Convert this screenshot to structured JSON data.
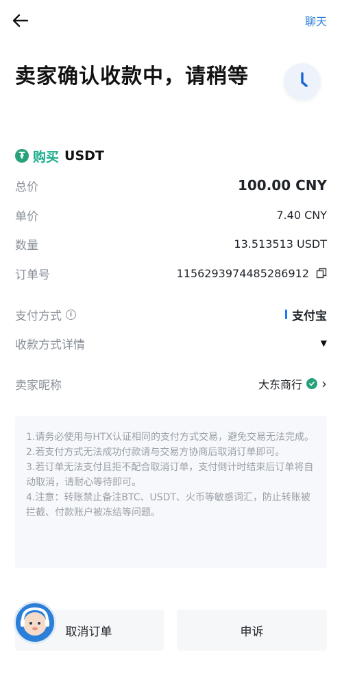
{
  "header": {
    "chat_label": "聊天"
  },
  "status": {
    "title": "卖家确认收款中，请稍等"
  },
  "order": {
    "action": "购买",
    "coin": "USDT",
    "rows": [
      {
        "label": "总价",
        "value": "100.00 CNY"
      },
      {
        "label": "单价",
        "value": "7.40 CNY"
      },
      {
        "label": "数量",
        "value": "13.513513 USDT"
      },
      {
        "label": "订单号",
        "value": "1156293974485286912"
      }
    ]
  },
  "payment": {
    "method_label": "支付方式",
    "method_value": "支付宝",
    "details_label": "收款方式详情",
    "seller_label": "卖家昵称",
    "seller_value": "大东商行"
  },
  "notice": {
    "lines": [
      "1.请务必使用与HTX认证相同的支付方式交易，避免交易无法完成。",
      "2.若支付方式无法成功付款请与交易方协商后取消订单即可。",
      "3.若订单无法支付且拒不配合取消订单，支付倒计时结束后订单将自动取消，请耐心等待即可。",
      "4.注意：转账禁止备注BTC、USDT、火币等敏感词汇，防止转账被拦截、付款账户被冻结等问题。"
    ]
  },
  "buttons": {
    "cancel": "取消订单",
    "appeal": "申诉"
  },
  "colors": {
    "accent": "#2b7fd8",
    "buy_green": "#1cae8c",
    "tether": "#27a17c"
  }
}
